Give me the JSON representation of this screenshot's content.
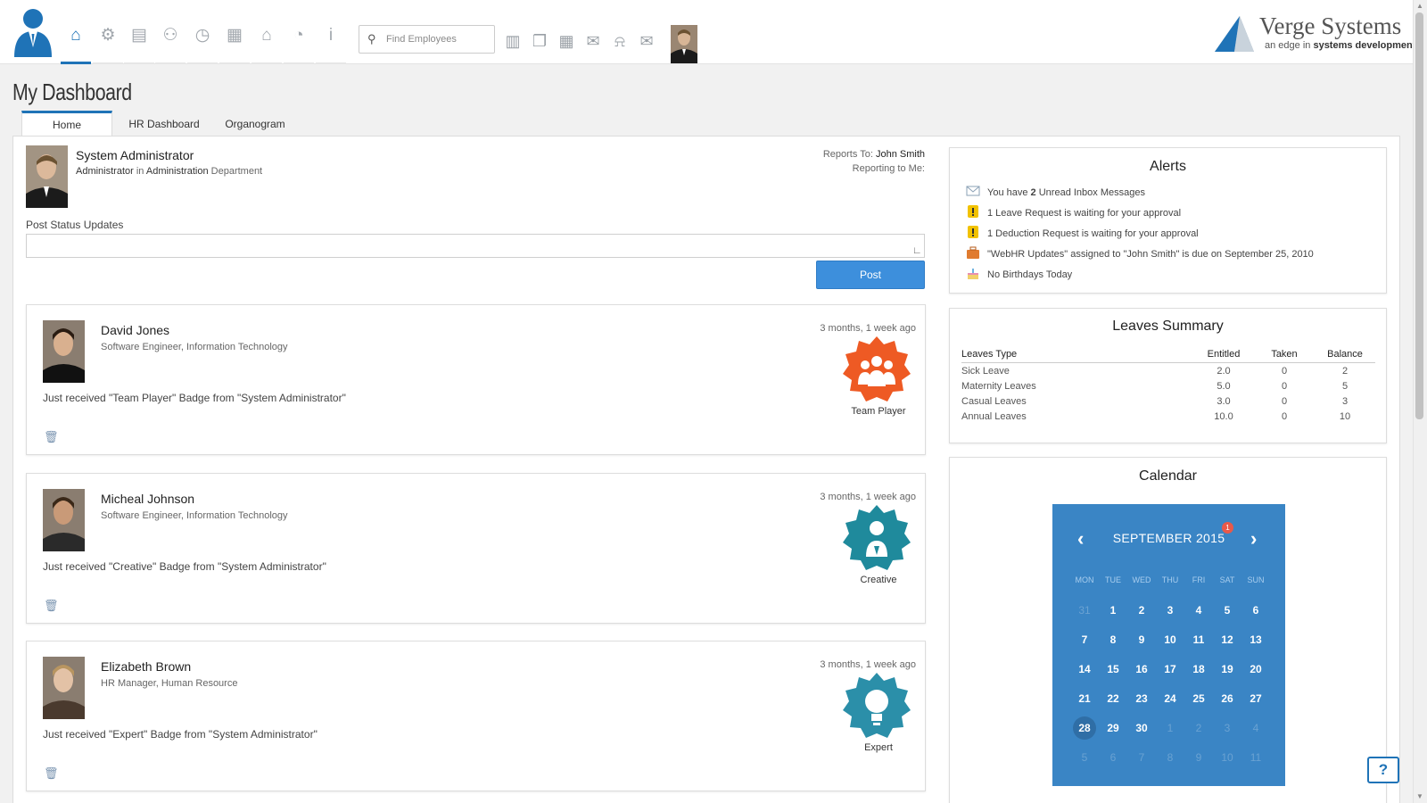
{
  "header": {
    "nav_icons": [
      "home-icon",
      "settings-gear-icon",
      "employee-card-icon",
      "people-icon",
      "clock-icon",
      "calculator-icon",
      "graduation-cap-icon",
      "pie-chart-icon",
      "info-icon"
    ],
    "search_placeholder": "Find Employees",
    "tool_icons": [
      "address-book-icon",
      "documents-icon",
      "calendar-grid-icon",
      "chat-icon",
      "bell-icon",
      "mail-icon"
    ],
    "brand_name": "Verge Systems",
    "brand_tag_prefix": "an edge in",
    "brand_tag_bold": "systems development",
    "accent_color": "#1f73b7"
  },
  "page": {
    "title": "My Dashboard",
    "tabs": [
      "Home",
      "HR Dashboard",
      "Organogram"
    ],
    "active_tab": "Home"
  },
  "profile": {
    "name": "System Administrator",
    "role": "Administrator",
    "in_text": "in",
    "department": "Administration",
    "department_suffix": "Department",
    "reports_to_label": "Reports To:",
    "reports_to": "John Smith",
    "reporting_to_me_label": "Reporting to Me:"
  },
  "status": {
    "label": "Post Status Updates",
    "value": "",
    "post_label": "Post"
  },
  "feed": [
    {
      "name": "David Jones",
      "title": "Software Engineer, Information Technology",
      "message": "Just received \"Team Player\" Badge from \"System Administrator\"",
      "time": "3 months, 1 week ago",
      "badge": "Team Player",
      "badge_color": "#ee5a24"
    },
    {
      "name": "Micheal Johnson",
      "title": "Software Engineer, Information Technology",
      "message": "Just received \"Creative\" Badge from \"System Administrator\"",
      "time": "3 months, 1 week ago",
      "badge": "Creative",
      "badge_color": "#1f8a9c"
    },
    {
      "name": "Elizabeth Brown",
      "title": "HR Manager, Human Resource",
      "message": "Just received \"Expert\" Badge from \"System Administrator\"",
      "time": "3 months, 1 week ago",
      "badge": "Expert",
      "badge_color": "#2b8fa9"
    }
  ],
  "alerts": {
    "title": "Alerts",
    "items": [
      {
        "icon": "inbox-icon",
        "prefix": "You have",
        "count": "2",
        "suffix": "Unread Inbox Messages"
      },
      {
        "icon": "warning-icon",
        "text": "1 Leave Request is waiting for your approval"
      },
      {
        "icon": "warning-icon",
        "text": "1 Deduction Request is waiting for your approval"
      },
      {
        "icon": "briefcase-icon",
        "text": "\"WebHR Updates\" assigned to \"John Smith\" is due on September 25, 2010"
      },
      {
        "icon": "cake-icon",
        "text": "No Birthdays Today"
      }
    ]
  },
  "leaves": {
    "title": "Leaves Summary",
    "columns": [
      "Leaves Type",
      "Entitled",
      "Taken",
      "Balance"
    ],
    "rows": [
      [
        "Sick Leave",
        "2.0",
        "0",
        "2"
      ],
      [
        "Maternity Leaves",
        "5.0",
        "0",
        "5"
      ],
      [
        "Casual Leaves",
        "3.0",
        "0",
        "3"
      ],
      [
        "Annual Leaves",
        "10.0",
        "0",
        "10"
      ]
    ]
  },
  "calendar": {
    "title": "Calendar",
    "month": "SEPTEMBER 2015",
    "notification_count": "1",
    "weekdays": [
      "MON",
      "TUE",
      "WED",
      "THU",
      "FRI",
      "SAT",
      "SUN"
    ],
    "weeks": [
      [
        "31",
        "1",
        "2",
        "3",
        "4",
        "5",
        "6"
      ],
      [
        "7",
        "8",
        "9",
        "10",
        "11",
        "12",
        "13"
      ],
      [
        "14",
        "15",
        "16",
        "17",
        "18",
        "19",
        "20"
      ],
      [
        "21",
        "22",
        "23",
        "24",
        "25",
        "26",
        "27"
      ],
      [
        "28",
        "29",
        "30",
        "1",
        "2",
        "3",
        "4"
      ],
      [
        "5",
        "6",
        "7",
        "8",
        "9",
        "10",
        "11"
      ]
    ],
    "today": "28",
    "color": "#3a85c5"
  },
  "help_label": "?"
}
